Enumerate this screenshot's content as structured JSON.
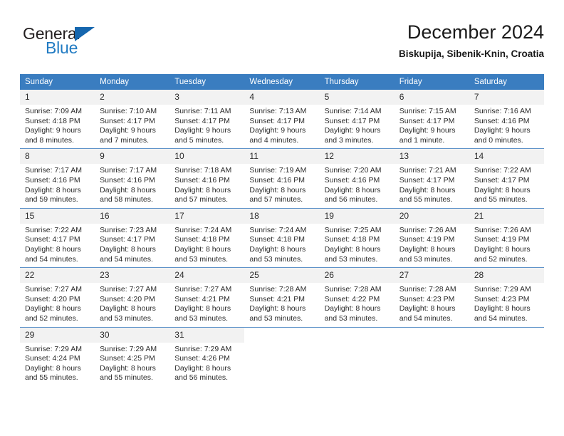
{
  "brand": {
    "name_top": "General",
    "name_bottom": "Blue",
    "triangle_icon": "blue-triangle-icon",
    "color_dark": "#231f20",
    "color_blue": "#1f7ac2"
  },
  "header": {
    "title": "December 2024",
    "subtitle": "Biskupija, Sibenik-Knin, Croatia"
  },
  "theme": {
    "header_row_bg": "#3a7dc0",
    "header_row_text": "#ffffff",
    "daynum_bg": "#f2f2f2",
    "cell_border": "#5f93c9"
  },
  "weekdays": [
    "Sunday",
    "Monday",
    "Tuesday",
    "Wednesday",
    "Thursday",
    "Friday",
    "Saturday"
  ],
  "weeks": [
    [
      {
        "day": "1",
        "sunrise": "Sunrise: 7:09 AM",
        "sunset": "Sunset: 4:18 PM",
        "daylight_line1": "Daylight: 9 hours",
        "daylight_line2": "and 8 minutes."
      },
      {
        "day": "2",
        "sunrise": "Sunrise: 7:10 AM",
        "sunset": "Sunset: 4:17 PM",
        "daylight_line1": "Daylight: 9 hours",
        "daylight_line2": "and 7 minutes."
      },
      {
        "day": "3",
        "sunrise": "Sunrise: 7:11 AM",
        "sunset": "Sunset: 4:17 PM",
        "daylight_line1": "Daylight: 9 hours",
        "daylight_line2": "and 5 minutes."
      },
      {
        "day": "4",
        "sunrise": "Sunrise: 7:13 AM",
        "sunset": "Sunset: 4:17 PM",
        "daylight_line1": "Daylight: 9 hours",
        "daylight_line2": "and 4 minutes."
      },
      {
        "day": "5",
        "sunrise": "Sunrise: 7:14 AM",
        "sunset": "Sunset: 4:17 PM",
        "daylight_line1": "Daylight: 9 hours",
        "daylight_line2": "and 3 minutes."
      },
      {
        "day": "6",
        "sunrise": "Sunrise: 7:15 AM",
        "sunset": "Sunset: 4:17 PM",
        "daylight_line1": "Daylight: 9 hours",
        "daylight_line2": "and 1 minute."
      },
      {
        "day": "7",
        "sunrise": "Sunrise: 7:16 AM",
        "sunset": "Sunset: 4:16 PM",
        "daylight_line1": "Daylight: 9 hours",
        "daylight_line2": "and 0 minutes."
      }
    ],
    [
      {
        "day": "8",
        "sunrise": "Sunrise: 7:17 AM",
        "sunset": "Sunset: 4:16 PM",
        "daylight_line1": "Daylight: 8 hours",
        "daylight_line2": "and 59 minutes."
      },
      {
        "day": "9",
        "sunrise": "Sunrise: 7:17 AM",
        "sunset": "Sunset: 4:16 PM",
        "daylight_line1": "Daylight: 8 hours",
        "daylight_line2": "and 58 minutes."
      },
      {
        "day": "10",
        "sunrise": "Sunrise: 7:18 AM",
        "sunset": "Sunset: 4:16 PM",
        "daylight_line1": "Daylight: 8 hours",
        "daylight_line2": "and 57 minutes."
      },
      {
        "day": "11",
        "sunrise": "Sunrise: 7:19 AM",
        "sunset": "Sunset: 4:16 PM",
        "daylight_line1": "Daylight: 8 hours",
        "daylight_line2": "and 57 minutes."
      },
      {
        "day": "12",
        "sunrise": "Sunrise: 7:20 AM",
        "sunset": "Sunset: 4:16 PM",
        "daylight_line1": "Daylight: 8 hours",
        "daylight_line2": "and 56 minutes."
      },
      {
        "day": "13",
        "sunrise": "Sunrise: 7:21 AM",
        "sunset": "Sunset: 4:17 PM",
        "daylight_line1": "Daylight: 8 hours",
        "daylight_line2": "and 55 minutes."
      },
      {
        "day": "14",
        "sunrise": "Sunrise: 7:22 AM",
        "sunset": "Sunset: 4:17 PM",
        "daylight_line1": "Daylight: 8 hours",
        "daylight_line2": "and 55 minutes."
      }
    ],
    [
      {
        "day": "15",
        "sunrise": "Sunrise: 7:22 AM",
        "sunset": "Sunset: 4:17 PM",
        "daylight_line1": "Daylight: 8 hours",
        "daylight_line2": "and 54 minutes."
      },
      {
        "day": "16",
        "sunrise": "Sunrise: 7:23 AM",
        "sunset": "Sunset: 4:17 PM",
        "daylight_line1": "Daylight: 8 hours",
        "daylight_line2": "and 54 minutes."
      },
      {
        "day": "17",
        "sunrise": "Sunrise: 7:24 AM",
        "sunset": "Sunset: 4:18 PM",
        "daylight_line1": "Daylight: 8 hours",
        "daylight_line2": "and 53 minutes."
      },
      {
        "day": "18",
        "sunrise": "Sunrise: 7:24 AM",
        "sunset": "Sunset: 4:18 PM",
        "daylight_line1": "Daylight: 8 hours",
        "daylight_line2": "and 53 minutes."
      },
      {
        "day": "19",
        "sunrise": "Sunrise: 7:25 AM",
        "sunset": "Sunset: 4:18 PM",
        "daylight_line1": "Daylight: 8 hours",
        "daylight_line2": "and 53 minutes."
      },
      {
        "day": "20",
        "sunrise": "Sunrise: 7:26 AM",
        "sunset": "Sunset: 4:19 PM",
        "daylight_line1": "Daylight: 8 hours",
        "daylight_line2": "and 53 minutes."
      },
      {
        "day": "21",
        "sunrise": "Sunrise: 7:26 AM",
        "sunset": "Sunset: 4:19 PM",
        "daylight_line1": "Daylight: 8 hours",
        "daylight_line2": "and 52 minutes."
      }
    ],
    [
      {
        "day": "22",
        "sunrise": "Sunrise: 7:27 AM",
        "sunset": "Sunset: 4:20 PM",
        "daylight_line1": "Daylight: 8 hours",
        "daylight_line2": "and 52 minutes."
      },
      {
        "day": "23",
        "sunrise": "Sunrise: 7:27 AM",
        "sunset": "Sunset: 4:20 PM",
        "daylight_line1": "Daylight: 8 hours",
        "daylight_line2": "and 53 minutes."
      },
      {
        "day": "24",
        "sunrise": "Sunrise: 7:27 AM",
        "sunset": "Sunset: 4:21 PM",
        "daylight_line1": "Daylight: 8 hours",
        "daylight_line2": "and 53 minutes."
      },
      {
        "day": "25",
        "sunrise": "Sunrise: 7:28 AM",
        "sunset": "Sunset: 4:21 PM",
        "daylight_line1": "Daylight: 8 hours",
        "daylight_line2": "and 53 minutes."
      },
      {
        "day": "26",
        "sunrise": "Sunrise: 7:28 AM",
        "sunset": "Sunset: 4:22 PM",
        "daylight_line1": "Daylight: 8 hours",
        "daylight_line2": "and 53 minutes."
      },
      {
        "day": "27",
        "sunrise": "Sunrise: 7:28 AM",
        "sunset": "Sunset: 4:23 PM",
        "daylight_line1": "Daylight: 8 hours",
        "daylight_line2": "and 54 minutes."
      },
      {
        "day": "28",
        "sunrise": "Sunrise: 7:29 AM",
        "sunset": "Sunset: 4:23 PM",
        "daylight_line1": "Daylight: 8 hours",
        "daylight_line2": "and 54 minutes."
      }
    ],
    [
      {
        "day": "29",
        "sunrise": "Sunrise: 7:29 AM",
        "sunset": "Sunset: 4:24 PM",
        "daylight_line1": "Daylight: 8 hours",
        "daylight_line2": "and 55 minutes."
      },
      {
        "day": "30",
        "sunrise": "Sunrise: 7:29 AM",
        "sunset": "Sunset: 4:25 PM",
        "daylight_line1": "Daylight: 8 hours",
        "daylight_line2": "and 55 minutes."
      },
      {
        "day": "31",
        "sunrise": "Sunrise: 7:29 AM",
        "sunset": "Sunset: 4:26 PM",
        "daylight_line1": "Daylight: 8 hours",
        "daylight_line2": "and 56 minutes."
      },
      {
        "day": "",
        "sunrise": "",
        "sunset": "",
        "daylight_line1": "",
        "daylight_line2": ""
      },
      {
        "day": "",
        "sunrise": "",
        "sunset": "",
        "daylight_line1": "",
        "daylight_line2": ""
      },
      {
        "day": "",
        "sunrise": "",
        "sunset": "",
        "daylight_line1": "",
        "daylight_line2": ""
      },
      {
        "day": "",
        "sunrise": "",
        "sunset": "",
        "daylight_line1": "",
        "daylight_line2": ""
      }
    ]
  ]
}
